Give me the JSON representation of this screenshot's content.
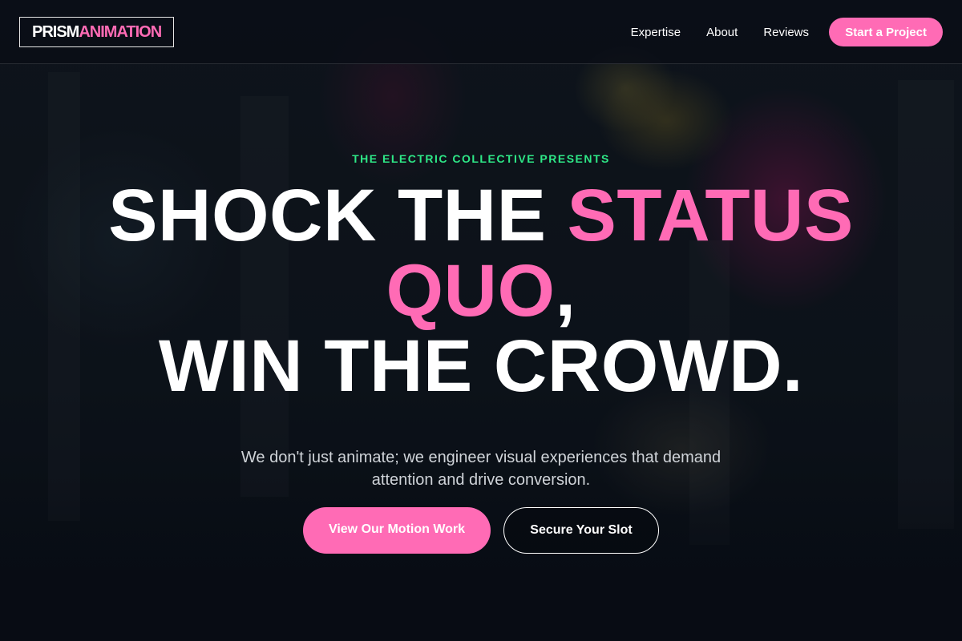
{
  "brand": {
    "name_part1": "PRISM",
    "name_part2": "ANIMATION",
    "accent_color": "#ff6bb5"
  },
  "nav": {
    "links": [
      {
        "label": "Expertise"
      },
      {
        "label": "About"
      },
      {
        "label": "Reviews"
      }
    ],
    "cta_label": "Start a Project"
  },
  "hero": {
    "eyebrow": "THE ELECTRIC COLLECTIVE PRESENTS",
    "eyebrow_color": "#2ee887",
    "headline": {
      "part1": "SHOCK THE ",
      "highlight1": "STATUS",
      "highlight2": "QUO",
      "part2": ",",
      "line3": "WIN THE CROWD."
    },
    "subtitle": "We don't just animate; we engineer visual experiences that demand attention and drive conversion.",
    "primary_button": "View Our Motion Work",
    "secondary_button": "Secure Your Slot",
    "background_image": "dark neon-lit street alley with pink paper lanterns"
  }
}
